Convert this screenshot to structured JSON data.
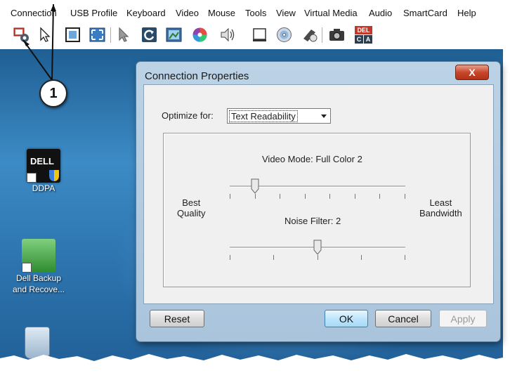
{
  "menu": [
    "Connection",
    "USB Profile",
    "Keyboard",
    "Video",
    "Mouse",
    "Tools",
    "View",
    "Virtual Media",
    "Audio",
    "SmartCard",
    "Help"
  ],
  "toolbar": {
    "icons": [
      "connection-properties-icon",
      "pointer-icon",
      "fit-window-icon",
      "full-screen-icon",
      "hide-cursor-icon",
      "refresh-icon",
      "screenshot-icon",
      "color-mode-icon",
      "audio-icon",
      "eject-icon",
      "virtual-media-cd-icon",
      "macros-icon",
      "capture-camera-icon",
      "ctrl-alt-del-icon"
    ],
    "ctrl_alt_del": {
      "top": "DEL",
      "bottom_left": "C",
      "bottom_right": "A"
    }
  },
  "desktop_icons": [
    {
      "label_lines": [
        "DDPA"
      ],
      "logo": "DELL"
    },
    {
      "label_lines": [
        "Dell Backup",
        "and Recove..."
      ]
    },
    {
      "label_lines": []
    }
  ],
  "callout": {
    "number": "1"
  },
  "dialog": {
    "title": "Connection Properties",
    "close_symbol": "X",
    "optimize_label": "Optimize for:",
    "optimize_value": "Text Readability",
    "video_mode_label": "Video Mode: Full Color 2",
    "best_quality": [
      "Best",
      "Quality"
    ],
    "least_bandwidth": [
      "Least",
      "Bandwidth"
    ],
    "noise_filter_label": "Noise Filter: 2",
    "video_slider": {
      "ticks": 8,
      "position": 1
    },
    "noise_slider": {
      "ticks": 5,
      "position": 2
    },
    "buttons": {
      "reset": "Reset",
      "ok": "OK",
      "cancel": "Cancel",
      "apply": "Apply"
    }
  },
  "colors": {
    "desktop": "#2f78b3",
    "dialog_frame": "#bcd3e6",
    "close_button": "#c8472c",
    "ok_button": "#bee6fd"
  }
}
